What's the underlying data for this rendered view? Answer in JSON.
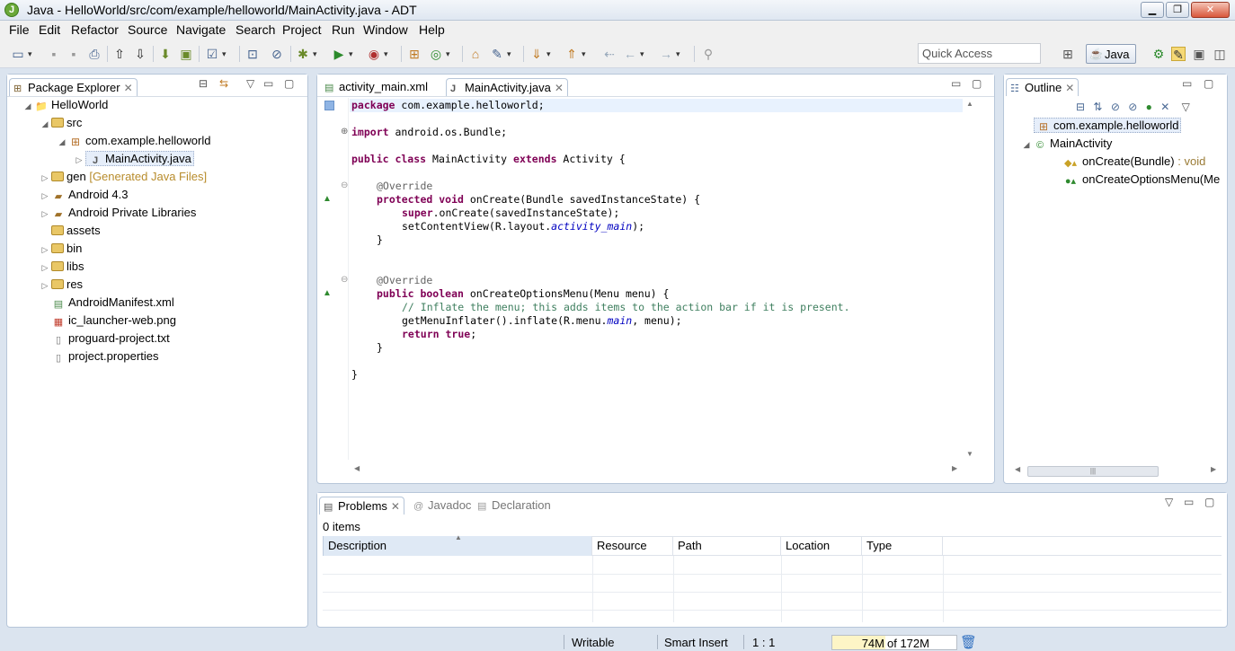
{
  "window": {
    "title": "Java - HelloWorld/src/com/example/helloworld/MainActivity.java - ADT",
    "app_icon": "J"
  },
  "menu": [
    "File",
    "Edit",
    "Refactor",
    "Source",
    "Navigate",
    "Search",
    "Project",
    "Run",
    "Window",
    "Help"
  ],
  "toolbar": {
    "quick_access_placeholder": "Quick Access",
    "perspective_label": "Java"
  },
  "package_explorer": {
    "tab_label": "Package Explorer",
    "tree": [
      {
        "label": "HelloWorld"
      },
      {
        "label": "src"
      },
      {
        "label": "com.example.helloworld"
      },
      {
        "label": "MainActivity.java"
      },
      {
        "label": "gen",
        "decoration": "[Generated Java Files]"
      },
      {
        "label": "Android 4.3"
      },
      {
        "label": "Android Private Libraries"
      },
      {
        "label": "assets"
      },
      {
        "label": "bin"
      },
      {
        "label": "libs"
      },
      {
        "label": "res"
      },
      {
        "label": "AndroidManifest.xml"
      },
      {
        "label": "ic_launcher-web.png"
      },
      {
        "label": "proguard-project.txt"
      },
      {
        "label": "project.properties"
      }
    ]
  },
  "editor": {
    "tabs": [
      {
        "label": "activity_main.xml",
        "active": false
      },
      {
        "label": "MainActivity.java",
        "active": true
      }
    ],
    "code": {
      "l1_kw": "package",
      "l1_rest": " com.example.helloworld;",
      "l2_kw": "import",
      "l2_rest": " android.os.Bundle;",
      "l3_kw1": "public class",
      "l3_mid": " MainActivity ",
      "l3_kw2": "extends",
      "l3_rest": " Activity {",
      "l4": "@Override",
      "l5_kw": "protected void",
      "l5_rest": " onCreate(Bundle savedInstanceState) {",
      "l6_kw": "super",
      "l6_rest": ".onCreate(savedInstanceState);",
      "l7_pre": "setContentView(R.layout.",
      "l7_it": "activity_main",
      "l7_post": ");",
      "l8": "}",
      "l9": "@Override",
      "l10_kw": "public boolean",
      "l10_rest": " onCreateOptionsMenu(Menu menu) {",
      "l11": "// Inflate the menu; this adds items to the action bar if it is present.",
      "l12_pre": "getMenuInflater().inflate(R.menu.",
      "l12_it": "main",
      "l12_post": ", menu);",
      "l13_kw": "return",
      "l13_kw2": "true",
      "l13_post": ";",
      "l14": "}",
      "l15": "}"
    }
  },
  "outline": {
    "tab_label": "Outline",
    "items": [
      {
        "label": "com.example.helloworld"
      },
      {
        "label": "MainActivity"
      },
      {
        "label": "onCreate(Bundle)",
        "type": " : void"
      },
      {
        "label": "onCreateOptionsMenu(Me"
      }
    ]
  },
  "problems": {
    "tabs": [
      "Problems",
      "Javadoc",
      "Declaration"
    ],
    "summary": "0 items",
    "columns": [
      "Description",
      "Resource",
      "Path",
      "Location",
      "Type"
    ]
  },
  "status": {
    "writable": "Writable",
    "insert_mode": "Smart Insert",
    "position": "1 : 1",
    "heap_used": "74M",
    "heap_total": "of 172M",
    "heap_fraction": 0.43
  },
  "colors": {
    "keyword": "#7f0055",
    "comment": "#3f7f5f",
    "field_italic": "#0000c0",
    "annotation": "#646464"
  }
}
